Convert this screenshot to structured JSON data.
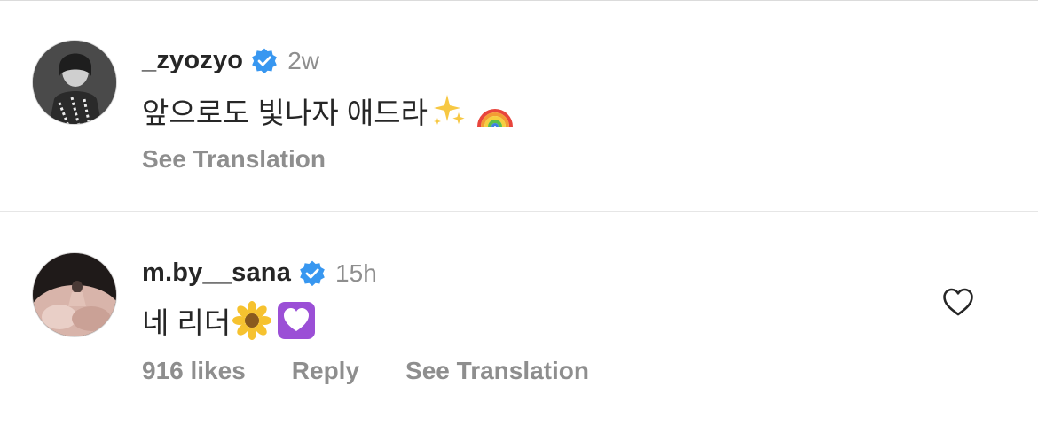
{
  "comments": [
    {
      "username": "_zyozyo",
      "time": "2w",
      "text": "앞으로도 빛나자 애드라",
      "emojis": [
        "sparkles-emoji",
        "rainbow-emoji"
      ],
      "see_translation": "See Translation"
    },
    {
      "username": "m.by__sana",
      "time": "15h",
      "text": "네 리더",
      "emojis": [
        "sunflower-emoji",
        "purple-heart-emoji"
      ],
      "likes": "916 likes",
      "reply": "Reply",
      "see_translation": "See Translation"
    }
  ],
  "colors": {
    "verified": "#3897f0",
    "muted": "#8e8e8e",
    "text": "#262626"
  }
}
